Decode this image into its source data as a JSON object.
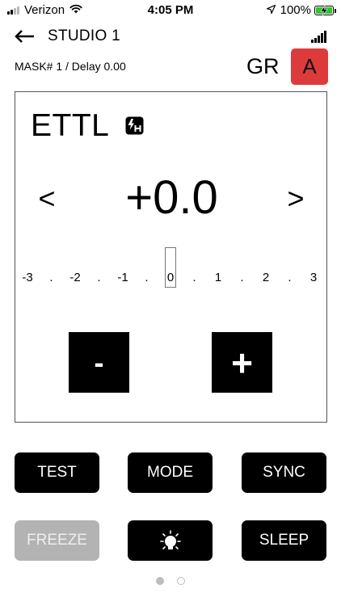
{
  "status_bar": {
    "carrier": "Verizon",
    "time": "4:05 PM",
    "battery_pct": "100%",
    "battery_level": 1.0,
    "battery_color": "#32c132",
    "signal_bars": 2,
    "icons": [
      "signal-icon",
      "wifi-icon",
      "location-icon",
      "battery-icon",
      "charging-icon"
    ]
  },
  "header": {
    "back_icon": "back-arrow-icon",
    "title": "STUDIO 1",
    "status_icon": "signal-strength-icon",
    "mask_info": "MASK# 1 / Delay 0.00",
    "group": "GR",
    "channel": "A",
    "channel_color": "#dd3b3b"
  },
  "panel": {
    "mode": "ETTL",
    "mode_icon": "flash-h-icon",
    "prev": "<",
    "next": ">",
    "value": "+0.0",
    "scale_labels": [
      "-3",
      "-2",
      "-1",
      "0",
      "1",
      "2",
      "3"
    ],
    "scale_separator": ".",
    "selected_index": 3,
    "decrement": "-",
    "increment": "+"
  },
  "buttons": {
    "test": "TEST",
    "mode": "MODE",
    "sync": "SYNC",
    "freeze": "FREEZE",
    "light_icon": "lamp-icon",
    "sleep": "SLEEP"
  },
  "pagination": {
    "pages": 2,
    "current": 1
  }
}
